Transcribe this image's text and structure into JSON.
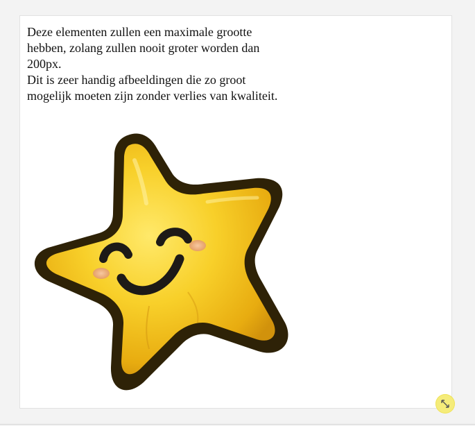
{
  "content": {
    "paragraph_1": "Deze elementen zullen een maximale grootte hebben, zolang zullen nooit groter worden dan 200px.",
    "paragraph_2": "Dit is zeer handig afbeeldingen die zo groot mogelijk moeten zijn zonder verlies van kwaliteit."
  },
  "image": {
    "subject": "smiling-star-icon"
  },
  "controls": {
    "resize_icon": "resize-arrows-icon"
  },
  "colors": {
    "page_background": "#f3f3f3",
    "panel_background": "#ffffff",
    "star_yellow": "#f5c91b",
    "star_outline": "#2e2207",
    "handle_yellow": "#f5ec7a"
  }
}
